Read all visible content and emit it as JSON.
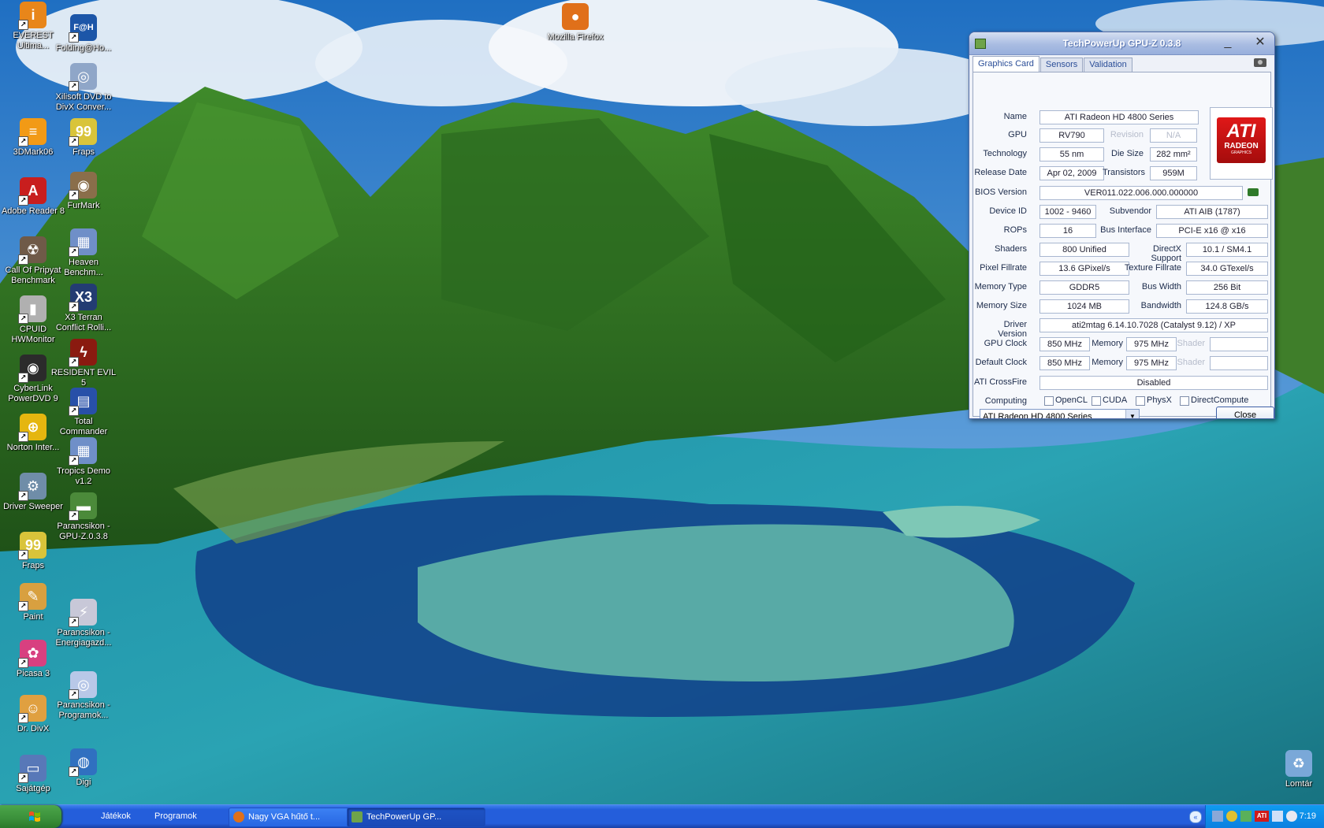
{
  "desktop": {
    "icons": [
      {
        "label": "EVEREST Ultima...",
        "icon": "everest-icon",
        "color": "#e8861a",
        "glyph": "i"
      },
      {
        "label": "Folding@Ho...",
        "icon": "folding-at-home-icon",
        "color": "#1c56a8",
        "glyph": "F@H"
      },
      {
        "label": "Xilisoft DVD to DivX Conver...",
        "icon": "dvd-disc-icon",
        "color": "#8fa6c8",
        "glyph": "◎"
      },
      {
        "label": "3DMark06",
        "icon": "3dmark-icon",
        "color": "#f29a16",
        "glyph": "≡"
      },
      {
        "label": "Fraps",
        "icon": "fraps-icon",
        "color": "#d9c43a",
        "glyph": "99"
      },
      {
        "label": "Adobe Reader 8",
        "icon": "adobe-reader-icon",
        "color": "#c81e1e",
        "glyph": "A"
      },
      {
        "label": "FurMark",
        "icon": "furmark-icon",
        "color": "#8a6e4a",
        "glyph": "◉"
      },
      {
        "label": "Call Of Pripyat Benchmark",
        "icon": "pripyat-icon",
        "color": "#6f5a48",
        "glyph": "☢"
      },
      {
        "label": "Heaven Benchm...",
        "icon": "heaven-icon",
        "color": "#6f8fc8",
        "glyph": "▦"
      },
      {
        "label": "CPUID HWMonitor",
        "icon": "hwmonitor-icon",
        "color": "#b0b0b0",
        "glyph": "▮"
      },
      {
        "label": "X3 Terran Conflict Rolli...",
        "icon": "x3-icon",
        "color": "#233c72",
        "glyph": "X3"
      },
      {
        "label": "CyberLink PowerDVD 9",
        "icon": "powerdvd-icon",
        "color": "#2b2b2b",
        "glyph": "◉"
      },
      {
        "label": "RESIDENT EVIL 5",
        "icon": "resident-evil-icon",
        "color": "#8a1a10",
        "glyph": "ϟ"
      },
      {
        "label": "Norton Inter...",
        "icon": "norton-icon",
        "color": "#e5b60f",
        "glyph": "⊕"
      },
      {
        "label": "Total Commander",
        "icon": "total-commander-icon",
        "color": "#2850a8",
        "glyph": "▤"
      },
      {
        "label": "Tropics Demo v1.2",
        "icon": "tropics-icon",
        "color": "#6f8fc8",
        "glyph": "▦"
      },
      {
        "label": "Driver Sweeper",
        "icon": "driver-sweeper-icon",
        "color": "#6f8da8",
        "glyph": "⚙"
      },
      {
        "label": "Parancsikon - GPU-Z.0.3.8",
        "icon": "gpuz-shortcut-icon",
        "color": "#4b8a3a",
        "glyph": "▬"
      },
      {
        "label": "Fraps",
        "icon": "fraps-icon",
        "color": "#d9c43a",
        "glyph": "99"
      },
      {
        "label": "Paint",
        "icon": "paint-icon",
        "color": "#d8a040",
        "glyph": "✎"
      },
      {
        "label": "Parancsikon - Energiagazd...",
        "icon": "energy-icon",
        "color": "#c8c8d8",
        "glyph": "⚡"
      },
      {
        "label": "Picasa 3",
        "icon": "picasa-icon",
        "color": "#d84080",
        "glyph": "✿"
      },
      {
        "label": "Parancsikon - Programok...",
        "icon": "programs-icon",
        "color": "#b8c8e8",
        "glyph": "◎"
      },
      {
        "label": "Dr. DivX",
        "icon": "dr-divx-icon",
        "color": "#e0a040",
        "glyph": "☺"
      },
      {
        "label": "Sajátgép",
        "icon": "my-computer-icon",
        "color": "#5878b8",
        "glyph": "▭"
      },
      {
        "label": "Digi",
        "icon": "digi-icon",
        "color": "#3070c0",
        "glyph": "◍"
      },
      {
        "label": "Mozilla Firefox",
        "icon": "firefox-icon",
        "color": "#e0701a",
        "glyph": "●"
      },
      {
        "label": "Lomtár",
        "icon": "recycle-bin-icon",
        "color": "#7aa8d8",
        "glyph": "♻"
      }
    ]
  },
  "gpuz": {
    "title": "TechPowerUp GPU-Z 0.3.8",
    "minimize": "_",
    "close": "✕",
    "tabs": [
      "Graphics Card",
      "Sensors",
      "Validation"
    ],
    "logo": {
      "brand": "ATI",
      "line1": "RADEON",
      "line2": "GRAPHICS"
    },
    "labels": {
      "name": "Name",
      "gpu": "GPU",
      "revision": "Revision",
      "technology": "Technology",
      "die_size": "Die Size",
      "release_date": "Release Date",
      "transistors": "Transistors",
      "bios_version": "BIOS Version",
      "device_id": "Device ID",
      "subvendor": "Subvendor",
      "rops": "ROPs",
      "bus_interface": "Bus Interface",
      "shaders": "Shaders",
      "directx": "DirectX Support",
      "pixel_fillrate": "Pixel Fillrate",
      "texture_fillrate": "Texture Fillrate",
      "memory_type": "Memory Type",
      "bus_width": "Bus Width",
      "memory_size": "Memory Size",
      "bandwidth": "Bandwidth",
      "driver_version": "Driver Version",
      "gpu_clock": "GPU Clock",
      "memory": "Memory",
      "shader": "Shader",
      "default_clock": "Default Clock",
      "crossfire": "ATI CrossFire",
      "computing": "Computing"
    },
    "values": {
      "name": "ATI Radeon HD 4800 Series",
      "gpu": "RV790",
      "revision": "N/A",
      "technology": "55 nm",
      "die_size": "282 mm²",
      "release_date": "Apr 02, 2009",
      "transistors": "959M",
      "bios_version": "VER011.022.006.000.000000",
      "device_id": "1002 - 9460",
      "subvendor": "ATI AIB (1787)",
      "rops": "16",
      "bus_interface": "PCI-E x16 @ x16",
      "shaders": "800 Unified",
      "directx": "10.1 / SM4.1",
      "pixel_fillrate": "13.6 GPixel/s",
      "texture_fillrate": "34.0 GTexel/s",
      "memory_type": "GDDR5",
      "bus_width": "256 Bit",
      "memory_size": "1024 MB",
      "bandwidth": "124.8 GB/s",
      "driver_version": "ati2mtag 6.14.10.7028 (Catalyst 9.12) / XP",
      "gpu_clock": "850 MHz",
      "memory_clock": "975 MHz",
      "shader_clock": "",
      "default_gpu_clock": "850 MHz",
      "default_memory_clock": "975 MHz",
      "default_shader_clock": "",
      "crossfire": "Disabled"
    },
    "computing": [
      "OpenCL",
      "CUDA",
      "PhysX",
      "DirectCompute"
    ],
    "selected_card": "ATI Radeon HD 4800 Series",
    "close_button": "Close"
  },
  "taskbar": {
    "toolbars": [
      "Játékok",
      "Programok"
    ],
    "tasks": [
      {
        "label": "Nagy VGA hűtő t...",
        "active": false
      },
      {
        "label": "TechPowerUp GP...",
        "active": true
      }
    ],
    "clock": "7:19",
    "tray_ati": "ATI"
  }
}
